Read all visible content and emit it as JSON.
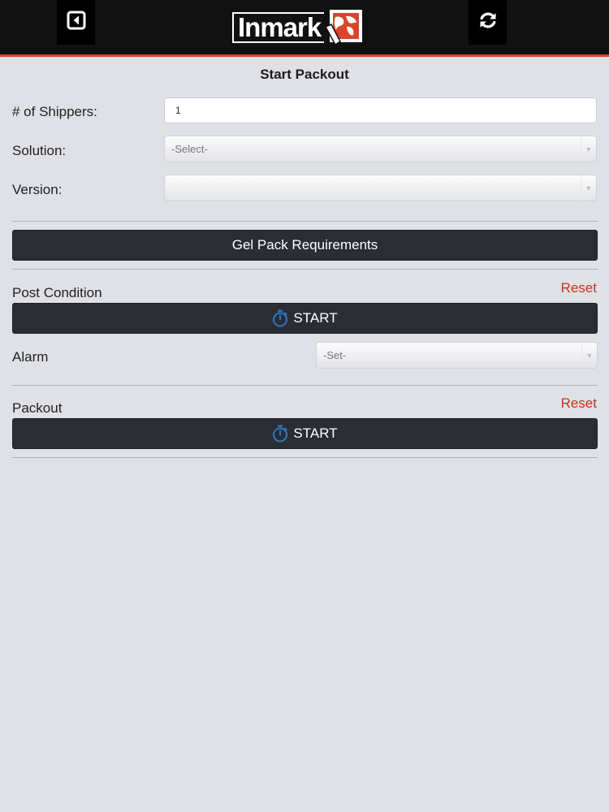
{
  "header": {
    "logo_text": "Inmark",
    "back_icon": "back-arrow-icon",
    "refresh_icon": "refresh-icon",
    "accent_color": "#d9442b"
  },
  "page": {
    "title": "Start Packout"
  },
  "form": {
    "shippers_label": "# of Shippers:",
    "shippers_value": "1",
    "solution_label": "Solution:",
    "solution_selected": "-Select-",
    "version_label": "Version:",
    "version_selected": ""
  },
  "gel_pack": {
    "button_label": "Gel Pack Requirements"
  },
  "post_condition": {
    "label": "Post Condition",
    "reset_label": "Reset",
    "start_label": "START",
    "start_icon": "stopwatch-icon",
    "alarm_label": "Alarm",
    "alarm_selected": "-Set-"
  },
  "packout": {
    "label": "Packout",
    "reset_label": "Reset",
    "start_label": "START",
    "start_icon": "stopwatch-icon"
  }
}
